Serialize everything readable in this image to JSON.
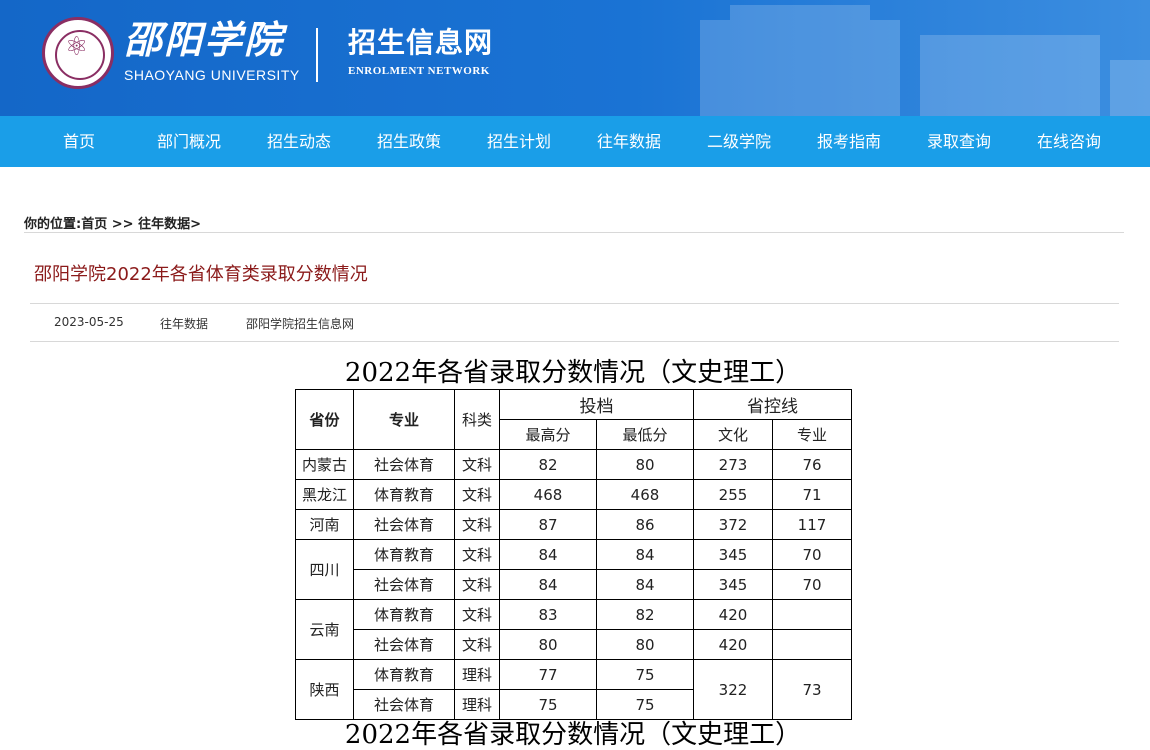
{
  "header": {
    "logo_cn": "邵阳学院",
    "logo_en": "SHAOYANG UNIVERSITY",
    "site_cn": "招生信息网",
    "site_en": "ENROLMENT NETWORK"
  },
  "nav": {
    "items": [
      {
        "label": "首页"
      },
      {
        "label": "部门概况"
      },
      {
        "label": "招生动态"
      },
      {
        "label": "招生政策"
      },
      {
        "label": "招生计划"
      },
      {
        "label": "往年数据"
      },
      {
        "label": "二级学院"
      },
      {
        "label": "报考指南"
      },
      {
        "label": "录取查询"
      },
      {
        "label": "在线咨询"
      }
    ]
  },
  "breadcrumb": {
    "prefix": "你的位置:",
    "home": "首页",
    "sep": ">>",
    "current": "往年数据",
    "trail": ">"
  },
  "article": {
    "title": "邵阳学院2022年各省体育类录取分数情况",
    "date": "2023-05-25",
    "category": "往年数据",
    "source": "邵阳学院招生信息网"
  },
  "table": {
    "title": "2022年各省录取分数情况（文史理工）",
    "headers": {
      "province": "省份",
      "major": "专业",
      "subject": "科类",
      "toudang": "投档",
      "shengkong": "省控线",
      "max": "最高分",
      "min": "最低分",
      "culture": "文化",
      "pro": "专业"
    },
    "rows": [
      [
        "内蒙古",
        "社会体育",
        "文科",
        "82",
        "80",
        "273",
        "76"
      ],
      [
        "黑龙江",
        "体育教育",
        "文科",
        "468",
        "468",
        "255",
        "71"
      ],
      [
        "河南",
        "社会体育",
        "文科",
        "87",
        "86",
        "372",
        "117"
      ],
      [
        "四川",
        "体育教育",
        "文科",
        "84",
        "84",
        "345",
        "70"
      ],
      [
        "",
        "社会体育",
        "文科",
        "84",
        "84",
        "345",
        "70"
      ],
      [
        "云南",
        "体育教育",
        "文科",
        "83",
        "82",
        "420",
        ""
      ],
      [
        "",
        "社会体育",
        "文科",
        "80",
        "80",
        "420",
        ""
      ],
      [
        "陕西",
        "体育教育",
        "理科",
        "77",
        "75",
        "322",
        "73"
      ],
      [
        "",
        "社会体育",
        "理科",
        "75",
        "75",
        "",
        ""
      ]
    ],
    "title2": "2022年各省录取分数情况（文史理工）"
  }
}
